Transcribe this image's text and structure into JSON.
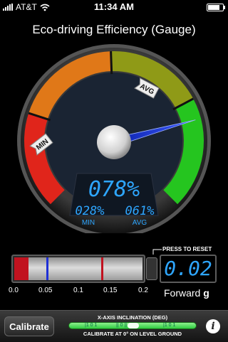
{
  "status_bar": {
    "carrier": "AT&T",
    "time": "11:34 AM",
    "battery_level": 0.85
  },
  "title": "Eco-driving Efficiency (Gauge)",
  "gauge": {
    "zone_labels": {
      "min": "MIN",
      "avg": "AVG"
    },
    "needle_value": 0.78,
    "current": "078%",
    "min_value": "028%",
    "avg_value": "061%",
    "min_label": "MIN",
    "avg_label": "AVG",
    "colors": {
      "red": "#e0251b",
      "orange": "#e07818",
      "olive": "#8f9a17",
      "green": "#25c51f",
      "needle": "#1f3de8",
      "digits": "#2ea6ff"
    }
  },
  "g_meter": {
    "press_to_reset": "PRESS TO RESET",
    "value": "0.02",
    "ticks": [
      "0.0",
      "0.05",
      "0.1",
      "0.15",
      "0.2"
    ],
    "unit_label": "Forward",
    "unit_symbol": "g",
    "blue_marker": 0.05,
    "red_marker": 0.135
  },
  "bottom_bar": {
    "calibrate_label": "Calibrate",
    "inclination_title": "X-AXIS INCLINATION (DEG)",
    "inclination_sub": "CALIBRATE AT 0° ON LEVEL GROUND",
    "inclination_value": 0,
    "info_icon": "i"
  }
}
